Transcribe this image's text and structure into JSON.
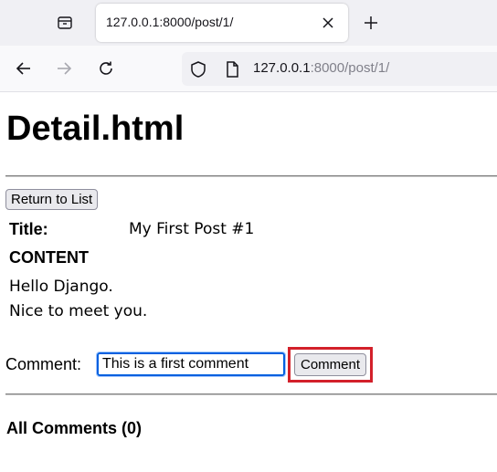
{
  "browser": {
    "tab": {
      "title": "127.0.0.1:8000/post/1/"
    },
    "url": {
      "host": "127.0.0.1",
      "rest": ":8000/post/1/"
    },
    "icons": {
      "tab_list": "tab-list-icon",
      "close": "close-icon",
      "new_tab": "plus-icon",
      "back": "arrow-left-icon",
      "forward": "arrow-right-icon",
      "reload": "reload-icon",
      "shield": "shield-icon",
      "page": "page-icon"
    },
    "colors": {
      "tabstrip": "#f0f0f4",
      "focus_border": "#0060df",
      "highlight": "#d3202a"
    }
  },
  "page": {
    "heading": "Detail.html",
    "return_button": "Return to List",
    "post": {
      "title_label": "Title:",
      "title_value": "My First Post #1",
      "content_label": "CONTENT",
      "content_lines": [
        "Hello Django.",
        "Nice to meet you."
      ]
    },
    "comment_form": {
      "label": "Comment:",
      "input_value": "This is a first comment",
      "submit_label": "Comment"
    },
    "all_comments": "All Comments (0)"
  }
}
